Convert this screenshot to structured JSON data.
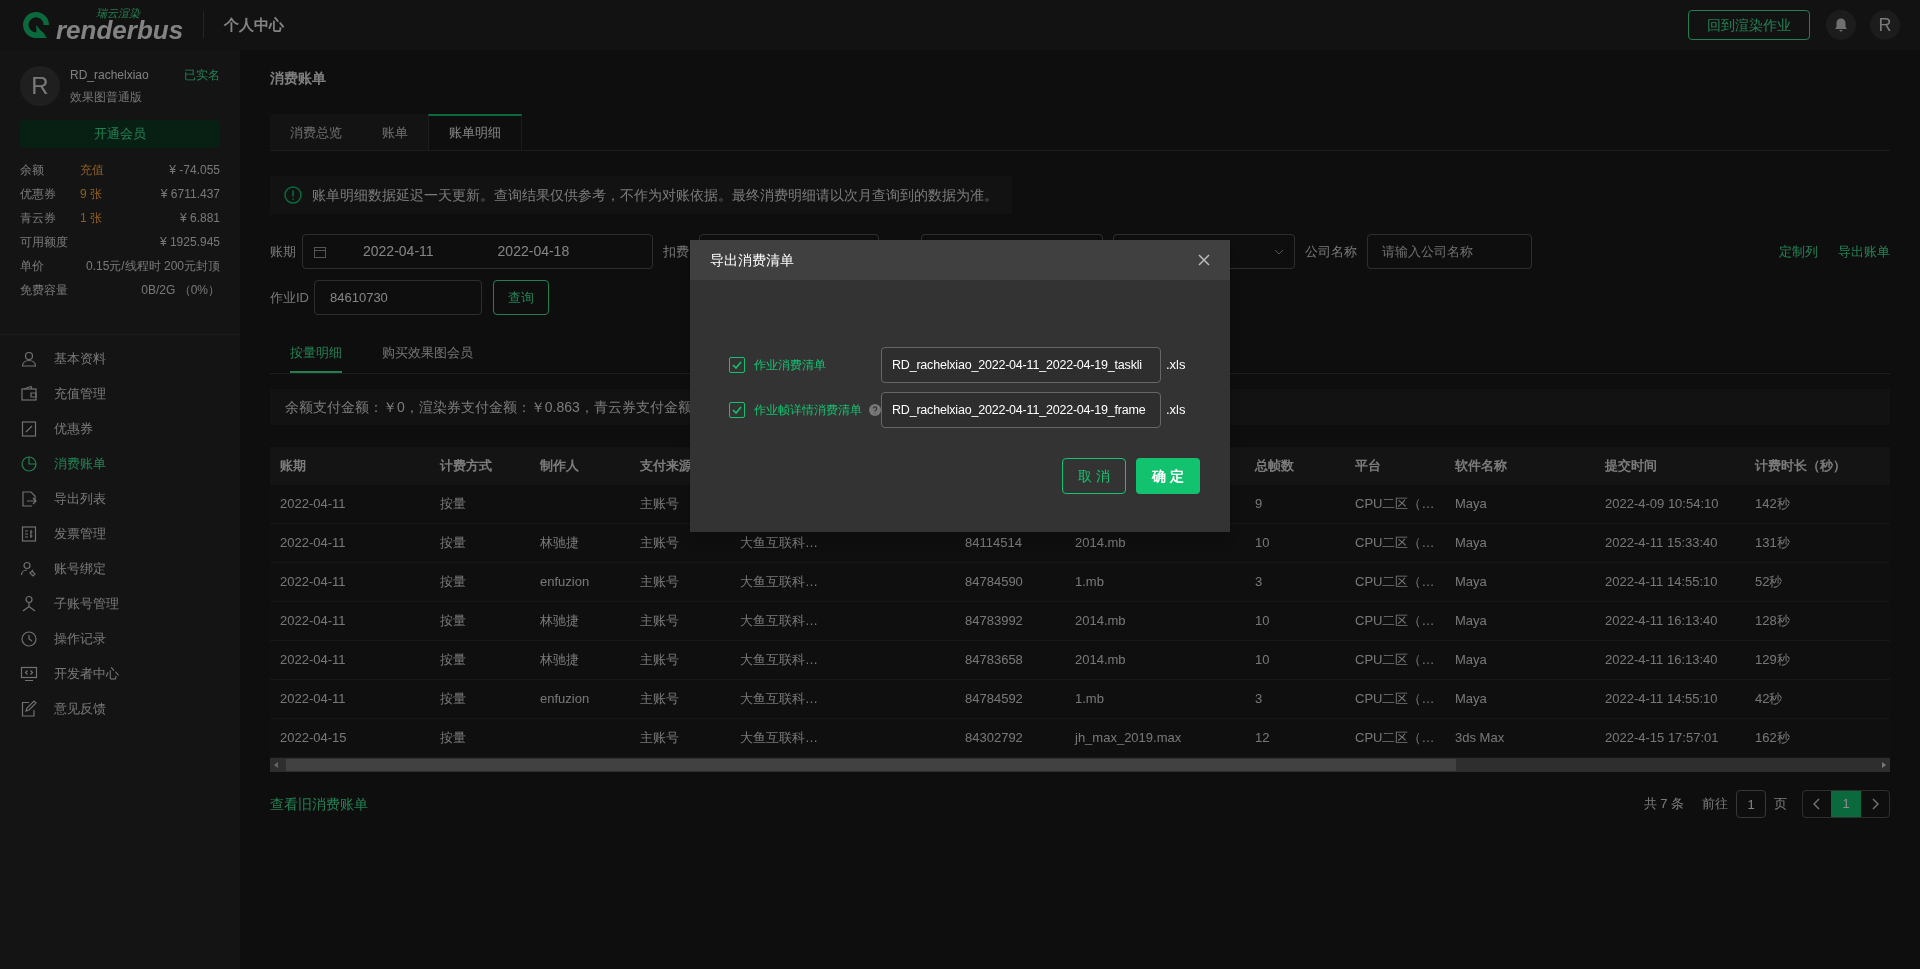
{
  "header": {
    "logo_caption": "瑞云渲染",
    "logo_word": "renderbus",
    "section": "个人中心",
    "back_button": "回到渲染作业",
    "avatar_letter": "R"
  },
  "account": {
    "avatar_letter": "R",
    "username": "RD_rachelxiao",
    "verified": "已实名",
    "plan": "效果图普通版",
    "member_button": "开通会员",
    "stats": [
      {
        "label": "余额",
        "action": "充值",
        "value": "¥ -74.055"
      },
      {
        "label": "优惠券",
        "action": "9 张",
        "value": "¥ 6711.437"
      },
      {
        "label": "青云券",
        "action": "1 张",
        "value": "¥ 6.881"
      },
      {
        "label": "可用额度",
        "value": "¥ 1925.945"
      },
      {
        "label": "单价",
        "value": "0.15元/线程时 200元封顶"
      },
      {
        "label": "免费容量",
        "value": "0B/2G （0%）"
      }
    ]
  },
  "sidebar": {
    "items": [
      {
        "label": "基本资料",
        "selected": false
      },
      {
        "label": "充值管理",
        "selected": false
      },
      {
        "label": "优惠券",
        "selected": false
      },
      {
        "label": "消费账单",
        "selected": true
      },
      {
        "label": "导出列表",
        "selected": false
      },
      {
        "label": "发票管理",
        "selected": false
      },
      {
        "label": "账号绑定",
        "selected": false
      },
      {
        "label": "子账号管理",
        "selected": false
      },
      {
        "label": "操作记录",
        "selected": false
      },
      {
        "label": "开发者中心",
        "selected": false
      },
      {
        "label": "意见反馈",
        "selected": false
      }
    ]
  },
  "page_title": "消费账单",
  "tabs": [
    {
      "label": "消费总览",
      "selected": false
    },
    {
      "label": "账单",
      "selected": false
    },
    {
      "label": "账单明细",
      "selected": true
    }
  ],
  "notice": "账单明细数据延迟一天更新。查询结果仅供参考，不作为对账依据。最终消费明细请以次月查询到的数据为准。",
  "filters": {
    "period_label": "账期",
    "start_date": "2022-04-11",
    "end_date": "2022-04-18",
    "deduction_label": "扣费",
    "company_label": "公司名称",
    "company_placeholder": "请输入公司名称",
    "job_id_label": "作业ID",
    "job_id": "84610730",
    "query_button": "查询"
  },
  "links": [
    "定制列",
    "导出账单"
  ],
  "subtabs": [
    {
      "label": "按量明细",
      "selected": true
    },
    {
      "label": "购买效果图会员",
      "selected": false
    }
  ],
  "summary": "余额支付金额：￥0，渲染券支付金额：￥0.863，青云券支付金额",
  "table": {
    "columns": {
      "period": "账期",
      "billing_method": "计费方式",
      "maker": "制作人",
      "payment_source": "支付来源",
      "total_frames": "总帧数",
      "platform": "平台",
      "software": "软件名称",
      "submit_time": "提交时间",
      "billed_duration": "计费时长（秒）"
    },
    "rows": [
      {
        "period": "2022-04-11",
        "billing_method": "按量",
        "payment_source": "主账号",
        "total_frames": "9",
        "platform": "CPU二区（…",
        "software": "Maya",
        "submit_time": "2022-4-09 10:54:10",
        "billed_duration": "142秒"
      },
      {
        "period": "2022-04-11",
        "billing_method": "按量",
        "maker": "林驰捷",
        "payment_source": "主账号",
        "column_5": "大鱼互联科…",
        "column_6": "84114514",
        "column_7": "2014.mb",
        "total_frames": "10",
        "platform": "CPU二区（…",
        "software": "Maya",
        "submit_time": "2022-4-11 15:33:40",
        "billed_duration": "131秒"
      },
      {
        "period": "2022-04-11",
        "billing_method": "按量",
        "maker": "enfuzion",
        "payment_source": "主账号",
        "column_5": "大鱼互联科…",
        "column_6": "84784590",
        "column_7": "1.mb",
        "total_frames": "3",
        "platform": "CPU二区（…",
        "software": "Maya",
        "submit_time": "2022-4-11 14:55:10",
        "billed_duration": "52秒"
      },
      {
        "period": "2022-04-11",
        "billing_method": "按量",
        "maker": "林驰捷",
        "payment_source": "主账号",
        "column_5": "大鱼互联科…",
        "column_6": "84783992",
        "column_7": "2014.mb",
        "total_frames": "10",
        "platform": "CPU二区（…",
        "software": "Maya",
        "submit_time": "2022-4-11 16:13:40",
        "billed_duration": "128秒"
      },
      {
        "period": "2022-04-11",
        "billing_method": "按量",
        "maker": "林驰捷",
        "payment_source": "主账号",
        "column_5": "大鱼互联科…",
        "column_6": "84783658",
        "column_7": "2014.mb",
        "total_frames": "10",
        "platform": "CPU二区（…",
        "software": "Maya",
        "submit_time": "2022-4-11 16:13:40",
        "billed_duration": "129秒"
      },
      {
        "period": "2022-04-11",
        "billing_method": "按量",
        "maker": "enfuzion",
        "payment_source": "主账号",
        "column_5": "大鱼互联科…",
        "column_6": "84784592",
        "column_7": "1.mb",
        "total_frames": "3",
        "platform": "CPU二区（…",
        "software": "Maya",
        "submit_time": "2022-4-11 14:55:10",
        "billed_duration": "42秒"
      },
      {
        "period": "2022-04-15",
        "billing_method": "按量",
        "payment_source": "主账号",
        "column_5": "大鱼互联科…",
        "column_6": "84302792",
        "column_7": "jh_max_2019.max",
        "total_frames": "12",
        "platform": "CPU二区（…",
        "software": "3ds Max",
        "submit_time": "2022-4-15 17:57:01",
        "billed_duration": "162秒"
      }
    ]
  },
  "old_bills_link": "查看旧消费账单",
  "pagination": {
    "total": "共 7 条",
    "goto_label": "前往",
    "goto_value": "1",
    "page_unit": "页",
    "pages": [
      {
        "label": "1",
        "selected": true
      }
    ]
  },
  "dialog": {
    "title": "导出消费清单",
    "options": [
      {
        "label": "作业消费清单",
        "checked": true,
        "help": false,
        "filename": "RD_rachelxiao_2022-04-11_2022-04-19_taskli",
        "extension": ".xls"
      },
      {
        "label": "作业帧详情消费清单",
        "checked": true,
        "help": true,
        "filename": "RD_rachelxiao_2022-04-11_2022-04-19_frame",
        "extension": ".xls"
      }
    ],
    "cancel": "取 消",
    "confirm": "确 定"
  }
}
